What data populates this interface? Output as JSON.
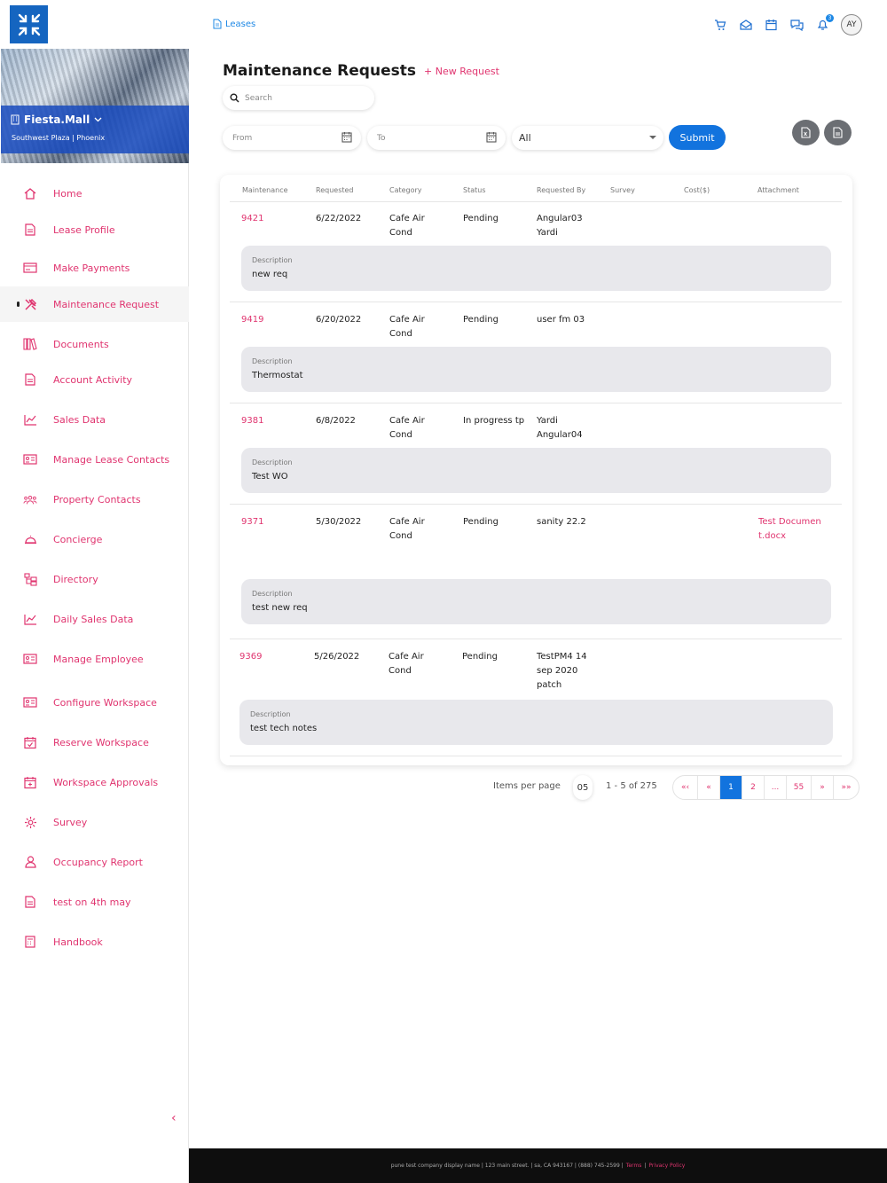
{
  "header": {
    "breadcrumb": "Leases",
    "notification_count": "3",
    "avatar_initials": "AY"
  },
  "sidebar": {
    "property_name": "Fiesta.Mall",
    "property_location": "Southwest Plaza | Phoenix",
    "items": [
      {
        "label": "Home",
        "icon": "home-icon"
      },
      {
        "label": "Lease Profile",
        "icon": "document-icon"
      },
      {
        "label": "Make Payments",
        "icon": "card-icon"
      },
      {
        "label": "Maintenance Request",
        "icon": "tools-icon"
      },
      {
        "label": "Documents",
        "icon": "books-icon"
      },
      {
        "label": "Account Activity",
        "icon": "document-icon"
      },
      {
        "label": "Sales Data",
        "icon": "chart-icon"
      },
      {
        "label": "Manage Lease Contacts",
        "icon": "id-card-icon"
      },
      {
        "label": "Property Contacts",
        "icon": "people-icon"
      },
      {
        "label": "Concierge",
        "icon": "bell-icon"
      },
      {
        "label": "Directory",
        "icon": "directory-icon"
      },
      {
        "label": "Daily Sales Data",
        "icon": "chart-icon"
      },
      {
        "label": "Manage Employee",
        "icon": "id-card-icon"
      },
      {
        "label": "Configure Workspace",
        "icon": "id-card-icon"
      },
      {
        "label": "Reserve Workspace",
        "icon": "calendar-check-icon"
      },
      {
        "label": "Workspace Approvals",
        "icon": "calendar-plus-icon"
      },
      {
        "label": "Survey",
        "icon": "gear-icon"
      },
      {
        "label": "Occupancy Report",
        "icon": "user-icon"
      },
      {
        "label": "test on 4th may",
        "icon": "document-icon"
      },
      {
        "label": "Handbook",
        "icon": "calculator-icon"
      }
    ]
  },
  "page": {
    "title": "Maintenance Requests",
    "new_request": "+ New Request",
    "search_placeholder": "Search",
    "from_placeholder": "From",
    "to_placeholder": "To",
    "status_selected": "All",
    "submit_label": "Submit"
  },
  "table": {
    "headers": [
      "Maintenance",
      "Requested",
      "Category",
      "Status",
      "Requested By",
      "Survey",
      "Cost($)",
      "Attachment"
    ],
    "description_label": "Description",
    "rows": [
      {
        "id": "9421",
        "requested": "6/22/2022",
        "category": "Cafe Air Cond",
        "status": "Pending",
        "requested_by": "Angular03 Yardi",
        "survey": "",
        "cost": "",
        "attachment": "",
        "description": "new req"
      },
      {
        "id": "9419",
        "requested": "6/20/2022",
        "category": "Cafe Air Cond",
        "status": "Pending",
        "requested_by": "user fm 03",
        "survey": "",
        "cost": "",
        "attachment": "",
        "description": "Thermostat"
      },
      {
        "id": "9381",
        "requested": "6/8/2022",
        "category": "Cafe Air Cond",
        "status": "In progress tp",
        "requested_by": "Yardi Angular04",
        "survey": "",
        "cost": "",
        "attachment": "",
        "description": "Test WO"
      },
      {
        "id": "9371",
        "requested": "5/30/2022",
        "category": "Cafe Air Cond",
        "status": "Pending",
        "requested_by": "sanity 22.2",
        "survey": "",
        "cost": "",
        "attachment": "Test Document.docx",
        "description": "test new req"
      },
      {
        "id": "9369",
        "requested": "5/26/2022",
        "category": "Cafe Air Cond",
        "status": "Pending",
        "requested_by": "TestPM4 14 sep 2020 patch",
        "survey": "",
        "cost": "",
        "attachment": "",
        "description": "test tech notes"
      }
    ]
  },
  "pagination": {
    "items_per_page_label": "Items per page",
    "items_per_page": "05",
    "range": "1 - 5 of 275",
    "first": "«‹",
    "prev": "«",
    "pages": [
      "1",
      "2",
      "...",
      "55"
    ],
    "current": "1",
    "next": "»",
    "last": "»»"
  },
  "footer": {
    "text": "pune test company display name | 123 main street. | sa, CA 943167 | (888) 745-2599 |",
    "terms": "Terms",
    "separator": "|",
    "privacy": "Privacy Policy"
  },
  "colors": {
    "accent_pink": "#e0346f",
    "primary_blue": "#1273de",
    "logo_blue": "#1565c0"
  }
}
